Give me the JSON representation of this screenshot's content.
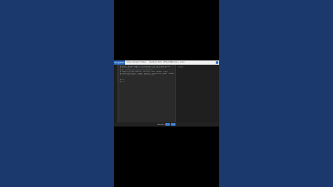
{
  "header": {
    "brand": "Programiz",
    "tabs": [
      "Online Compiler",
      "Python",
      "JavaScript",
      "SQL",
      "HTML/CSS",
      "Premium",
      "Learn"
    ]
  },
  "editor": {
    "lines": [
      "# Online Python compiler (interpreter) to run Python online.",
      "# Write Python 3 code in this online editor and run it.",
      "# Get started with interactive Python!",
      "# Supports Python Modules: builtins, math, pandas, scipy",
      "# matplotlib.pyplot, numpy, operator, processing, pygal, random,",
      "# re, string, time, turtle, urllib.request",
      "",
      "",
      "a = 5",
      "b = 6"
    ],
    "line_numbers": [
      "1",
      "2",
      "3",
      "4",
      "5",
      "6",
      "7",
      "8",
      "9",
      "10"
    ]
  },
  "output": {
    "label": "Output"
  },
  "bottom": {
    "label": "Shortcuts",
    "run": "Run",
    "save": "Save"
  },
  "colors": {
    "brand": "#2d6cc4",
    "background": "#1b396c"
  }
}
